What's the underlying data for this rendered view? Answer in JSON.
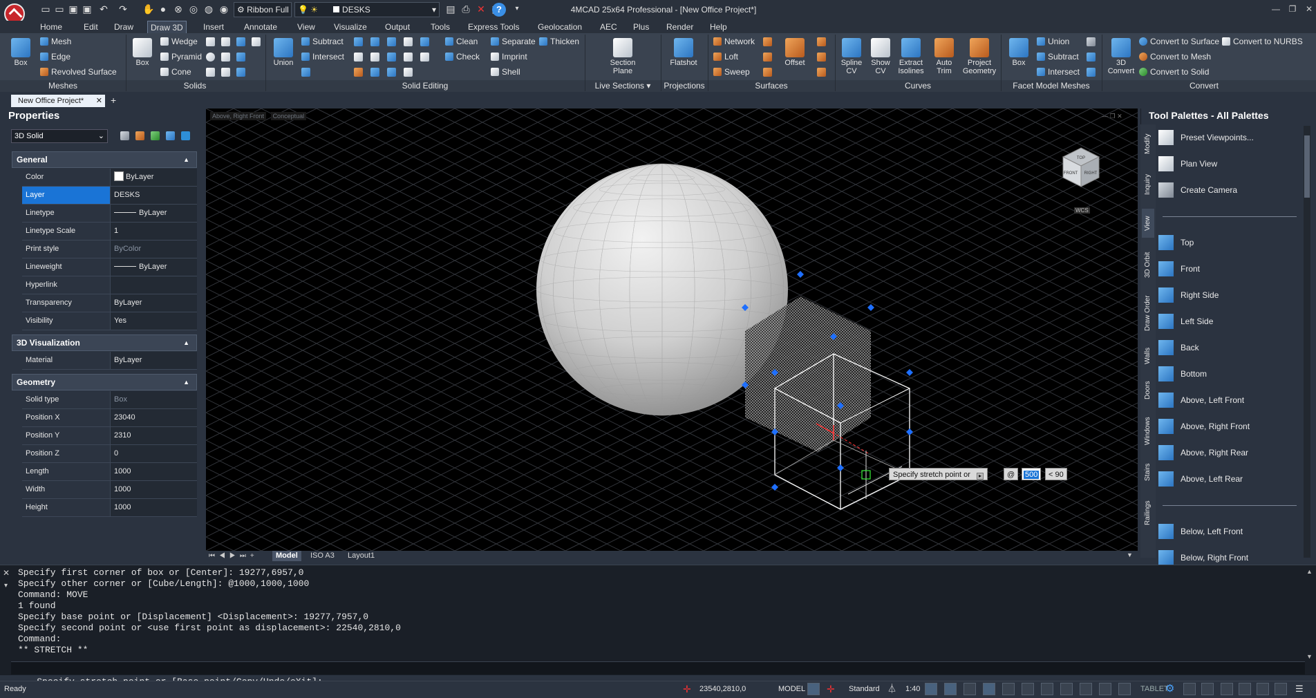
{
  "titlebar": {
    "app_title": "4MCAD 25x64 Professional - [New Office Project*]",
    "workspace_dropdown": "Ribbon Full",
    "layer_dropdown": "DESKS"
  },
  "menus": [
    "Home",
    "Edit",
    "Draw",
    "Draw 3D",
    "Insert",
    "Annotate",
    "View",
    "Visualize",
    "Output",
    "Tools",
    "Express Tools",
    "Geolocation",
    "AEC",
    "Plus",
    "Render",
    "Help"
  ],
  "active_menu": "Draw 3D",
  "ribbon": {
    "panels": [
      "Meshes",
      "Solids",
      "Solid Editing",
      "Live Sections",
      "Projections",
      "Surfaces",
      "Curves",
      "Facet Model Meshes",
      "Convert"
    ],
    "meshes": {
      "big": "Box",
      "items": [
        "Mesh",
        "Edge",
        "Revolved Surface"
      ]
    },
    "solids": {
      "big": "Box",
      "items": [
        "Wedge",
        "Pyramid",
        "Cone"
      ]
    },
    "solid_editing": {
      "big": "Union",
      "items": [
        "Subtract",
        "Intersect"
      ],
      "items2": [
        "Clean",
        "Check"
      ],
      "items3": [
        "Separate",
        "Imprint",
        "Shell"
      ],
      "thicken": "Thicken"
    },
    "live_sections": {
      "big1": "Section",
      "big2": "Plane"
    },
    "projections": {
      "big": "Flatshot"
    },
    "surfaces": {
      "items": [
        "Network",
        "Loft",
        "Sweep"
      ],
      "big": "Offset"
    },
    "curves": {
      "spline1": "Spline",
      "spline2": "CV",
      "show1": "Show",
      "show2": "CV",
      "extract1": "Extract",
      "extract2": "Isolines",
      "auto1": "Auto",
      "auto2": "Trim",
      "project1": "Project",
      "project2": "Geometry"
    },
    "facet": {
      "big": "Box",
      "items": [
        "Union",
        "Subtract",
        "Intersect"
      ]
    },
    "convert": {
      "big1": "3D",
      "big2": "Convert",
      "items": [
        "Convert to Surface",
        "Convert to Mesh",
        "Convert to Solid"
      ],
      "nurbs": "Convert to NURBS"
    }
  },
  "doc_tab": "New Office Project*",
  "properties": {
    "title": "Properties",
    "selector": "3D Solid",
    "sections": {
      "general": "General",
      "viz": "3D Visualization",
      "geometry": "Geometry"
    },
    "general_rows": [
      {
        "k": "Color",
        "v": "ByLayer"
      },
      {
        "k": "Layer",
        "v": "DESKS"
      },
      {
        "k": "Linetype",
        "v": "ByLayer"
      },
      {
        "k": "Linetype Scale",
        "v": "1"
      },
      {
        "k": "Print style",
        "v": "ByColor"
      },
      {
        "k": "Lineweight",
        "v": "ByLayer"
      },
      {
        "k": "Hyperlink",
        "v": ""
      },
      {
        "k": "Transparency",
        "v": "ByLayer"
      },
      {
        "k": "Visibility",
        "v": "Yes"
      }
    ],
    "viz_rows": [
      {
        "k": "Material",
        "v": "ByLayer"
      }
    ],
    "geometry_rows": [
      {
        "k": "Solid type",
        "v": "Box"
      },
      {
        "k": "Position X",
        "v": "23040"
      },
      {
        "k": "Position Y",
        "v": "2310"
      },
      {
        "k": "Position Z",
        "v": "0"
      },
      {
        "k": "Length",
        "v": "1000"
      },
      {
        "k": "Width",
        "v": "1000"
      },
      {
        "k": "Height",
        "v": "1000"
      }
    ]
  },
  "viewport": {
    "view_label": "Above, Right Front",
    "style_label": "Conceptual",
    "viewcube": {
      "top": "TOP",
      "front": "FRONT",
      "right": "RIGHT",
      "wcs": "WCS"
    },
    "dyn_prompt": "Specify stretch point or",
    "dyn_at": "@",
    "dyn_value": "500",
    "dyn_angle": "< 90"
  },
  "layout_tabs": [
    "Model",
    "ISO A3",
    "Layout1"
  ],
  "tool_palette": {
    "title": "Tool Palettes - All Palettes",
    "vertical_tabs": [
      "Modify",
      "Inquiry",
      "View",
      "3D Orbit",
      "Draw Order",
      "Walls",
      "Doors",
      "Windows",
      "Stairs",
      "Railings"
    ],
    "group1": [
      "Preset Viewpoints...",
      "Plan View",
      "Create Camera"
    ],
    "group2": [
      "Top",
      "Front",
      "Right Side",
      "Left Side",
      "Back",
      "Bottom",
      "Above, Left Front",
      "Above, Right Front",
      "Above, Right Rear",
      "Above, Left Rear"
    ],
    "group3": [
      "Below, Left Front",
      "Below, Right Front"
    ]
  },
  "command_history": [
    "Specify first corner of box or [Center]: 19277,6957,0",
    "Specify other corner or [Cube/Length]: @1000,1000,1000",
    "Command: MOVE",
    "1 found",
    "Specify base point or [Displacement] <Displacement>: 19277,7957,0",
    "Specify second point or <use first point as displacement>: 22540,2810,0",
    "Command:",
    "** STRETCH **"
  ],
  "command_prompt": {
    "prefix": "Specify stretch point or [",
    "opt1": "Base point",
    "opt2": "Copy",
    "opt3": "Undo",
    "opt4": "eXit",
    "suffix": "]:"
  },
  "status": {
    "ready": "Ready",
    "coords": "23540,2810,0",
    "space": "MODEL",
    "style": "Standard",
    "scale": "1:40",
    "tablet": "TABLET"
  },
  "colors": {
    "accent": "#1a74d6",
    "viewport_bg": "#000000",
    "grip_blue": "#1e6fff",
    "grid": "#3a3d44"
  }
}
